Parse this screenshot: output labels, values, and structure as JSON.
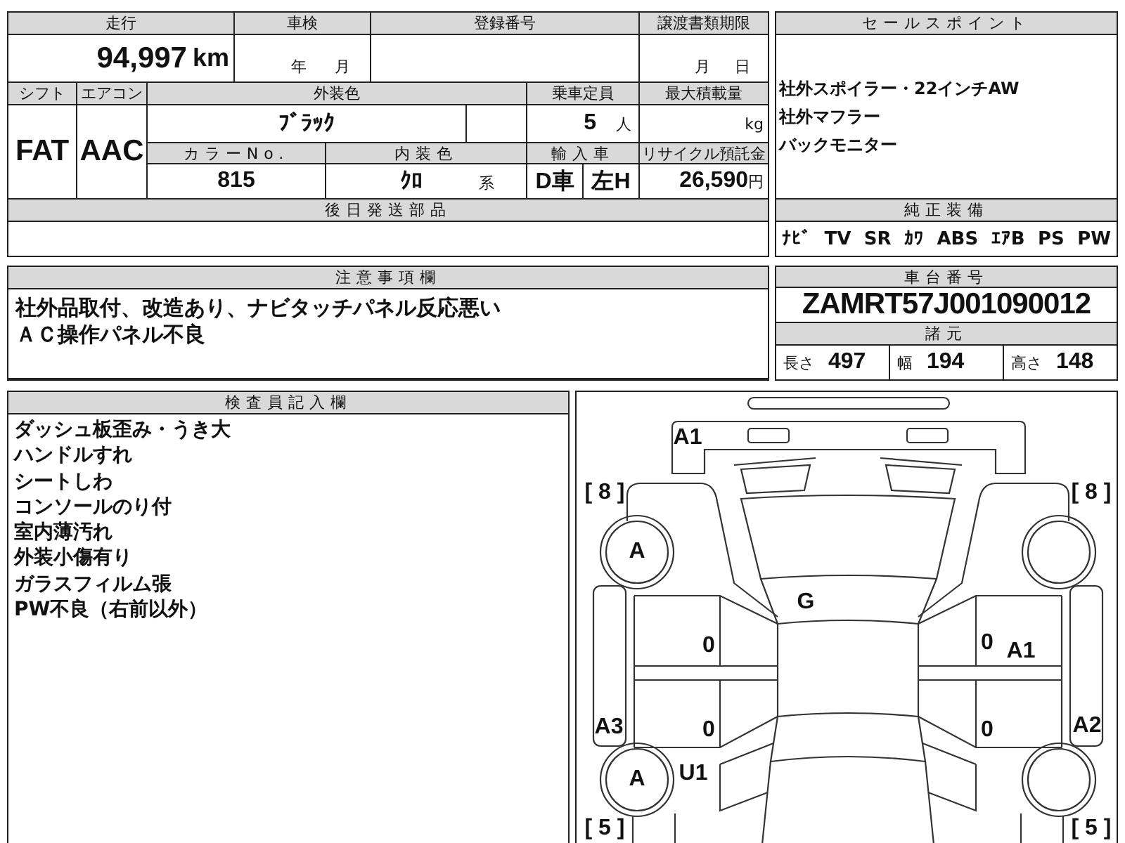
{
  "mileage": {
    "label": "走行",
    "value": "94,997",
    "unit": "km"
  },
  "inspection": {
    "label": "車検",
    "year_unit": "年",
    "month_unit": "月"
  },
  "registration_number": {
    "label": "登録番号"
  },
  "transfer_deadline": {
    "label": "譲渡書類期限",
    "month_unit": "月",
    "day_unit": "日"
  },
  "shift": {
    "label": "シフト",
    "value": "FAT"
  },
  "air_conditioner": {
    "label": "エアコン",
    "value": "AAC"
  },
  "exterior_color": {
    "label": "外装色",
    "value": "ﾌﾞﾗｯｸ"
  },
  "capacity": {
    "label": "乗車定員",
    "value": "5",
    "unit": "人"
  },
  "max_load": {
    "label": "最大積載量",
    "unit": "kg"
  },
  "color_no": {
    "label": "カラーNo.",
    "value": "815"
  },
  "interior_color": {
    "label": "内装色",
    "value": "ｸﾛ",
    "suffix": "系"
  },
  "import": {
    "label": "輸入車",
    "values": [
      "D車",
      "左H"
    ]
  },
  "recycle_fee": {
    "label": "リサイクル預託金",
    "value": "26,590",
    "unit": "円"
  },
  "later_parts": {
    "label": "後日発送部品"
  },
  "sale_points": {
    "label": "セールスポイント",
    "lines": [
      "社外スポイラー・22インチAW",
      "社外マフラー",
      "バックモニター"
    ]
  },
  "equipment": {
    "label": "純正装備",
    "items": [
      "ﾅﾋﾞ",
      "TV",
      "SR",
      "ｶﾜ",
      "ABS",
      "ｴｱB",
      "PS",
      "PW"
    ]
  },
  "notes": {
    "label": "注意事項欄",
    "lines": [
      "社外品取付、改造あり、ナビタッチパネル反応悪い",
      "ＡＣ操作パネル不良"
    ]
  },
  "chassis_number": {
    "label": "車台番号",
    "value": "ZAMRT57J001090012"
  },
  "specs": {
    "label": "諸元",
    "items": [
      {
        "label": "長さ",
        "value": "497"
      },
      {
        "label": "幅",
        "value": "194"
      },
      {
        "label": "高さ",
        "value": "148"
      }
    ]
  },
  "inspector_notes": {
    "label": "検査員記入欄",
    "lines": [
      "ダッシュ板歪み・うき大",
      "ハンドルすれ",
      "シートしわ",
      "コンソールのり付",
      "室内薄汚れ",
      "外装小傷有り",
      "ガラスフィルム張",
      "PW不良（右前以外）"
    ]
  },
  "diagram": {
    "marks": [
      "A1",
      "[ 8 ]",
      "[ 8 ]",
      "A",
      "G",
      "0",
      "0",
      "A1",
      "A3",
      "0",
      "0",
      "A2",
      "U1",
      "A",
      "[ 5 ]",
      "[ 5 ]"
    ]
  }
}
